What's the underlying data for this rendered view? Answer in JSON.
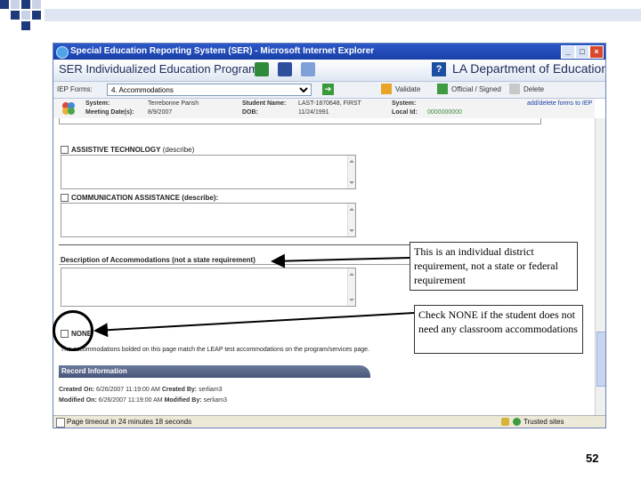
{
  "window": {
    "title": "Special Education Reporting System (SER) - Microsoft Internet Explorer",
    "min_label": "_",
    "max_label": "□",
    "close_label": "×"
  },
  "header": {
    "app_title": "SER Individualized Education Program",
    "dept": "LA Department of Education",
    "help_label": "?"
  },
  "toolbar": {
    "forms_label": "IEP Forms:",
    "selected_form": "4. Accommodations",
    "validate": "Validate",
    "official": "Official / Signed",
    "delete": "Delete"
  },
  "student": {
    "system_label": "System:",
    "system_value": "Terrebonne Parish",
    "student_label": "Student Name:",
    "student_value": "LAST-1870648, FIRST",
    "meeting_label": "Meeting Date(s):",
    "meeting_value": "8/9/2007",
    "dob_label": "DOB:",
    "dob_value": "11/24/1991",
    "local_label": "Local Id:",
    "local_value": "0000000000",
    "link": "add/delete forms to IEP"
  },
  "form": {
    "assistive": "ASSISTIVE TECHNOLOGY",
    "assistive_describe": "(describe)",
    "communication": "COMMUNICATION ASSISTANCE (describe):",
    "description": "Description of Accommodations",
    "description_note": "(not a state requirement)",
    "none": "NONE",
    "leap_text": "The accommodations bolded on this page match the LEAP test accommodations on the program/services page.",
    "record_header": "Record Information",
    "created_label": "Created On:",
    "created_value": "6/26/2007 11:19:00 AM",
    "created_by_label": "Created By:",
    "created_by_value": "serliam3",
    "modified_label": "Modified On:",
    "modified_value": "6/26/2007 11:19:00 AM",
    "modified_by_label": "Modified By:",
    "modified_by_value": "serliam3"
  },
  "statusbar": {
    "timeout": "Page timeout in 24 minutes 18 seconds",
    "zone": "Trusted sites"
  },
  "callouts": {
    "district": "This is an individual district requirement, not a state or federal requirement",
    "none": "Check NONE if the student does not need any classroom accommodations"
  },
  "slide": {
    "page_number": "52"
  },
  "colors": {
    "title_bar": "#1840a8",
    "record_header": "#46557a",
    "deco_square": "#1f3a7a"
  }
}
